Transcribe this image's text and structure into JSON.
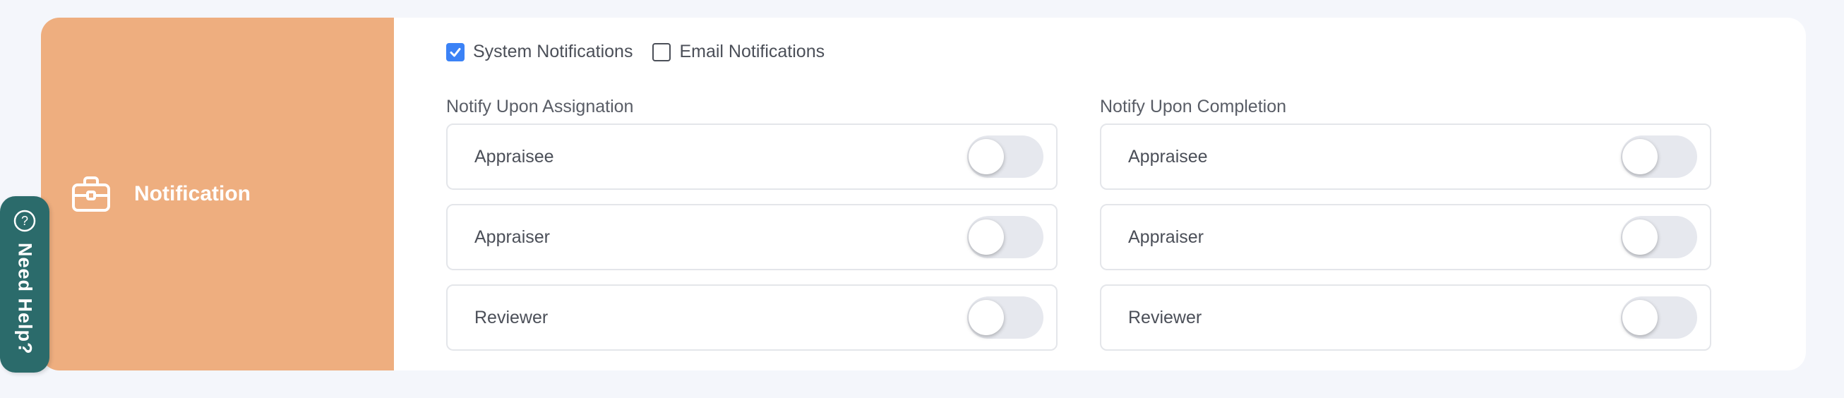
{
  "panel": {
    "title": "Notification",
    "icon": "briefcase-icon",
    "accent_color": "#eeae7f"
  },
  "channels": [
    {
      "label": "System Notifications",
      "checked": true
    },
    {
      "label": "Email Notifications",
      "checked": false
    }
  ],
  "groups": [
    {
      "heading": "Notify Upon Assignation",
      "items": [
        {
          "label": "Appraisee",
          "enabled": false
        },
        {
          "label": "Appraiser",
          "enabled": false
        },
        {
          "label": "Reviewer",
          "enabled": false
        }
      ]
    },
    {
      "heading": "Notify Upon Completion",
      "items": [
        {
          "label": "Appraisee",
          "enabled": false
        },
        {
          "label": "Appraiser",
          "enabled": false
        },
        {
          "label": "Reviewer",
          "enabled": false
        }
      ]
    }
  ],
  "help_button": {
    "label": "Need Help?",
    "icon": "question-circle-icon",
    "color": "#2b6b6b"
  }
}
